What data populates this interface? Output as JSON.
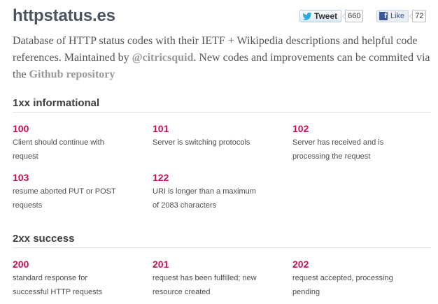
{
  "header": {
    "site_title": "httpstatus.es",
    "tweet_label": "Tweet",
    "tweet_count": "660",
    "like_label": "Like",
    "like_count": "72"
  },
  "intro": {
    "text_1": "Database of HTTP status codes with their IETF + Wikipedia descriptions and helpful code references. Maintained by ",
    "author_link": "@citricsquid",
    "text_2": ". New codes and improvements can be commited via the ",
    "repo_link": "Github repository"
  },
  "sections": [
    {
      "title": "1xx informational",
      "codes": [
        {
          "code": "100",
          "desc": "Client should continue with request"
        },
        {
          "code": "101",
          "desc": "Server is switching protocols"
        },
        {
          "code": "102",
          "desc": "Server has received and is processing the request"
        },
        {
          "code": "103",
          "desc": "resume aborted PUT or POST requests"
        },
        {
          "code": "122",
          "desc": "URI is longer than a maximum of 2083 characters"
        }
      ]
    },
    {
      "title": "2xx success",
      "codes": [
        {
          "code": "200",
          "desc": "standard response for successful HTTP requests"
        },
        {
          "code": "201",
          "desc": "request has been fulfilled; new resource created"
        },
        {
          "code": "202",
          "desc": "request accepted, processing pending"
        }
      ]
    }
  ],
  "colors": {
    "code_accent": "#c5115a",
    "link_muted": "#999999",
    "heading": "#4a5560"
  }
}
